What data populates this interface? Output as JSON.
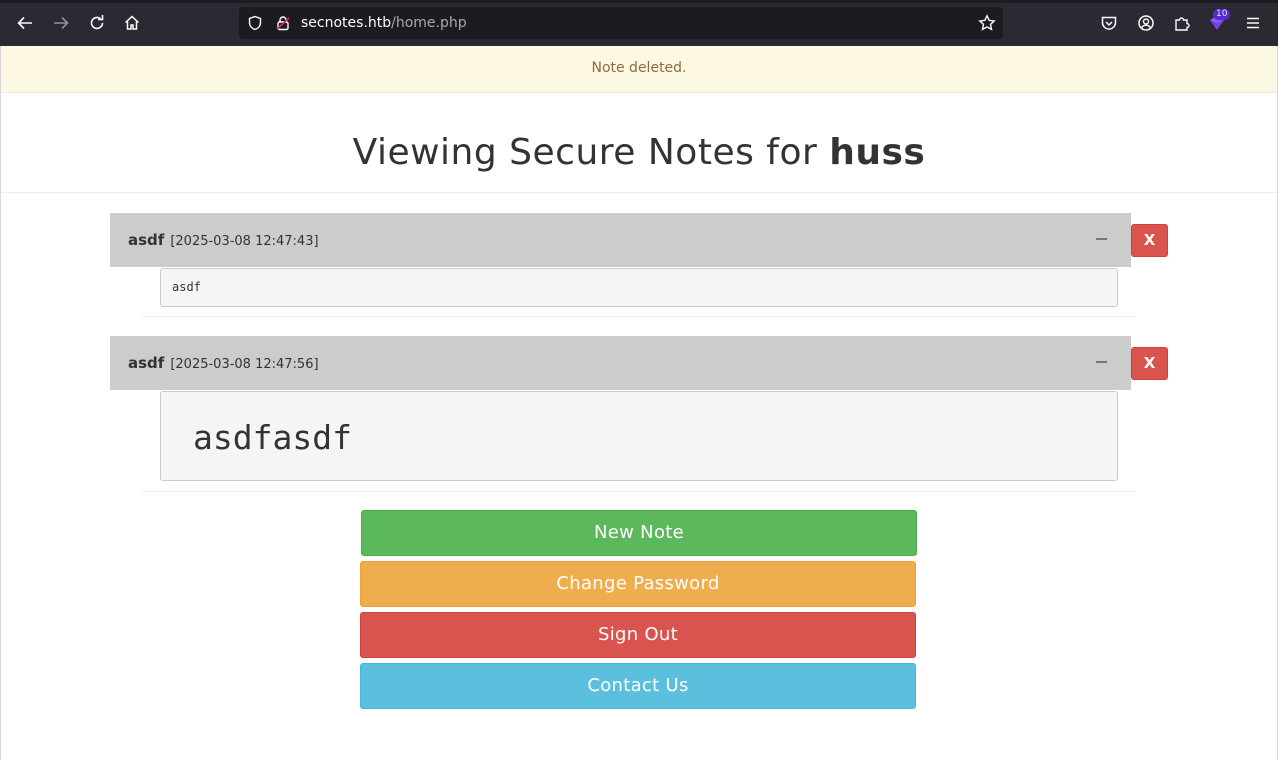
{
  "browser": {
    "url_host": "secnotes.htb",
    "url_path": "/home.php",
    "extension_badge": "10"
  },
  "alert": {
    "message": "Note deleted."
  },
  "heading": {
    "prefix": "Viewing Secure Notes for ",
    "username": "huss"
  },
  "notes": [
    {
      "title": "asdf",
      "date": "[2025-03-08 12:47:43]",
      "body": "asdf",
      "delete_label": "X"
    },
    {
      "title": "asdf",
      "date": "[2025-03-08 12:47:56]",
      "body": "asdfasdf",
      "delete_label": "X"
    }
  ],
  "actions": {
    "new_note": "New Note",
    "change_password": "Change Password",
    "sign_out": "Sign Out",
    "contact_us": "Contact Us"
  },
  "colors": {
    "success": "#5cb85c",
    "warning": "#f0ad4e",
    "danger": "#d9534f",
    "info": "#5bc0de",
    "alert_bg": "#fcf8e3"
  }
}
